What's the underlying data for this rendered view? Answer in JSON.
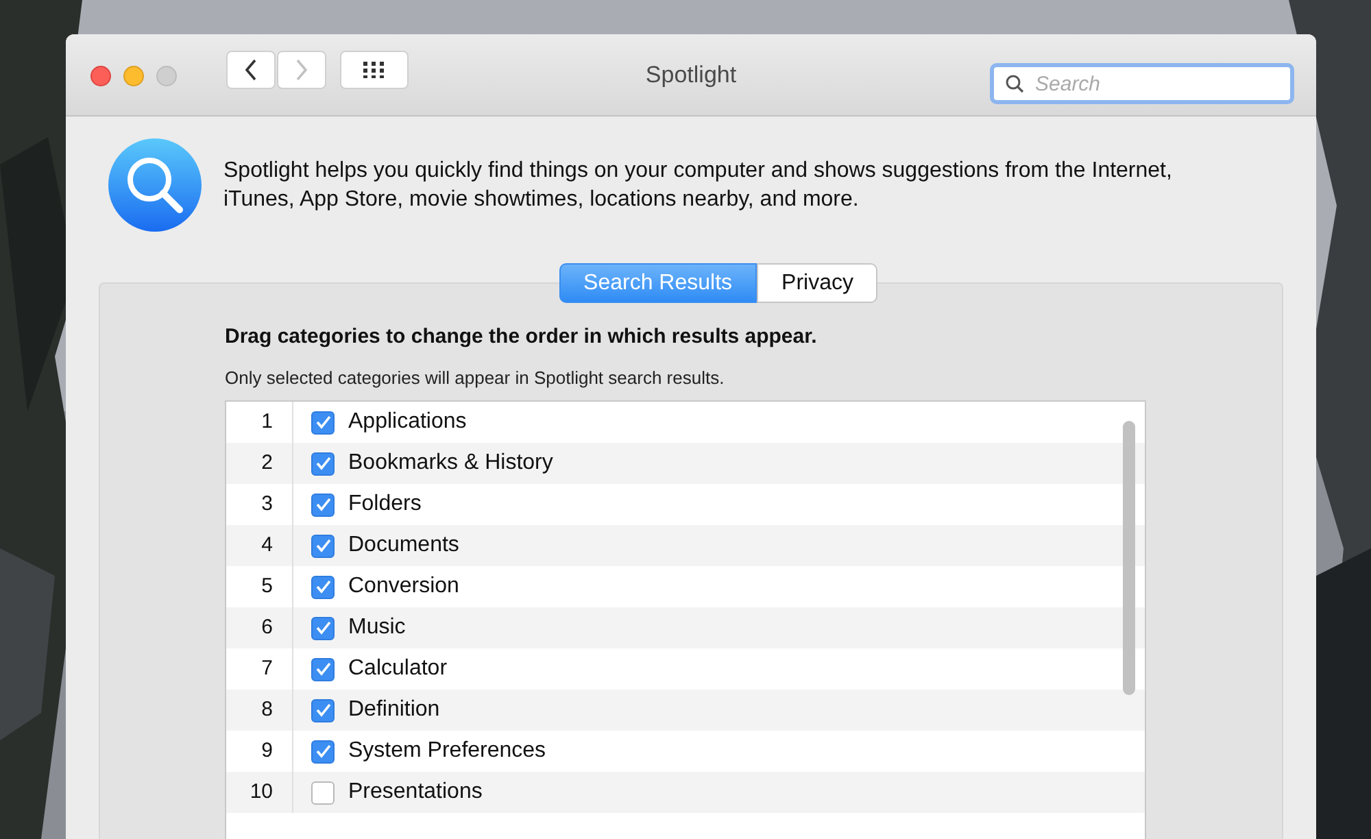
{
  "window": {
    "title": "Spotlight"
  },
  "toolbar": {
    "back_enabled": true,
    "forward_enabled": false
  },
  "search": {
    "placeholder": "Search"
  },
  "description": "Spotlight helps you quickly find things on your computer and shows suggestions from the Internet, iTunes, App Store, movie showtimes, locations nearby, and more.",
  "tabs": [
    {
      "label": "Search Results",
      "selected": true
    },
    {
      "label": "Privacy",
      "selected": false
    }
  ],
  "heading": "Drag categories to change the order in which results appear.",
  "note": "Only selected categories will appear in Spotlight search results.",
  "categories": [
    {
      "number": "1",
      "label": "Applications",
      "checked": true
    },
    {
      "number": "2",
      "label": "Bookmarks & History",
      "checked": true
    },
    {
      "number": "3",
      "label": "Folders",
      "checked": true
    },
    {
      "number": "4",
      "label": "Documents",
      "checked": true
    },
    {
      "number": "5",
      "label": "Conversion",
      "checked": true
    },
    {
      "number": "6",
      "label": "Music",
      "checked": true
    },
    {
      "number": "7",
      "label": "Calculator",
      "checked": true
    },
    {
      "number": "8",
      "label": "Definition",
      "checked": true
    },
    {
      "number": "9",
      "label": "System Preferences",
      "checked": true
    },
    {
      "number": "10",
      "label": "Presentations",
      "checked": false
    }
  ]
}
